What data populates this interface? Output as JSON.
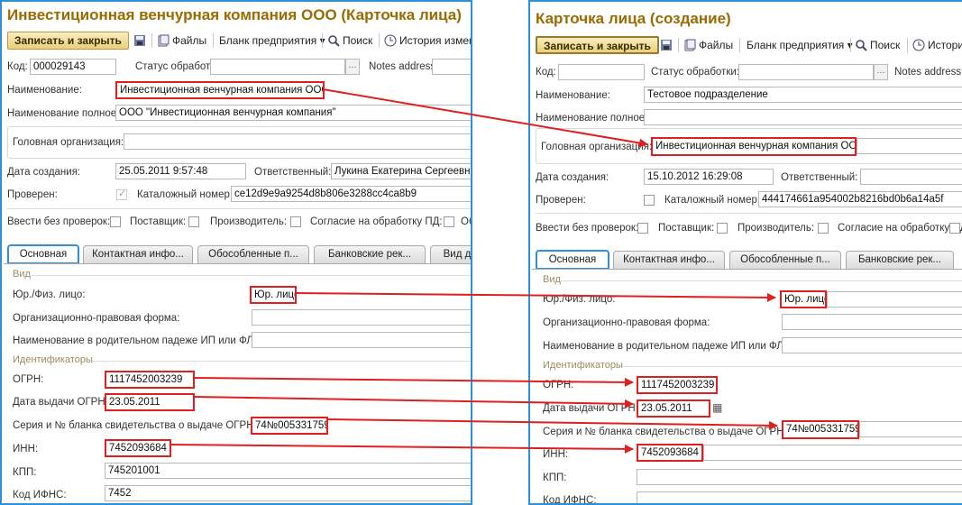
{
  "left": {
    "title": "Инвестиционная венчурная компания ООО (Карточка лица)",
    "toolbar": {
      "save_close": "Записать и закрыть",
      "files": "Файлы",
      "forms": "Бланк предприятия",
      "search": "Поиск",
      "history": "История измен"
    },
    "code_label": "Код:",
    "code_value": "000029143",
    "status_label": "Статус обработки:",
    "status_value": "",
    "notes_label": "Notes address:",
    "name_label": "Наименование:",
    "name_value": "Инвестиционная венчурная компания ООО",
    "fullname_label": "Наименование полное:",
    "fullname_value": "ООО \"Инвестиционная венчурная компания\"",
    "parent_label": "Головная организация:",
    "parent_value": "",
    "created_label": "Дата создания:",
    "created_value": "25.05.2011  9:57:48",
    "resp_label": "Ответственный:",
    "resp_value": "Лукина Екатерина Сергеевна",
    "checked_label": "Проверен:",
    "catalog_label": "Каталожный номер:",
    "catalog_value": "ce12d9e9a9254d8b806e3288cc4ca8b9",
    "noverify_label": "Ввести без проверок:",
    "supplier_label": "Поставщик:",
    "producer_label": "Производитель:",
    "consent_label": "Согласие на обработку ПД:",
    "consent_tail": "Об",
    "tabs": [
      "Основная",
      "Контактная инфо...",
      "Обособленные п...",
      "Банковские рек...",
      "Вид д"
    ],
    "group_vid": "Вид",
    "type_label": "Юр./Физ. лицо:",
    "type_value": "Юр. лицо",
    "legal_form_label": "Организационно-правовая форма:",
    "genitive_label": "Наименование в родительном падеже ИП или ФЛ:",
    "group_ids": "Идентификаторы",
    "ogrn_label": "ОГРН:",
    "ogrn_value": "1117452003239",
    "ogrn_date_label": "Дата выдачи ОГРН",
    "ogrn_date_value": "23.05.2011",
    "cert_label": "Серия и № бланка свидетельства о выдаче ОГРН :",
    "cert_value": "74№005331759",
    "inn_label": "ИНН:",
    "inn_value": "7452093684",
    "kpp_label": "КПП:",
    "kpp_value": "745201001",
    "ifns_label": "Код ИФНС:",
    "ifns_value": "7452"
  },
  "right": {
    "title": "Карточка лица (создание)",
    "toolbar": {
      "save_close": "Записать и закрыть",
      "files": "Файлы",
      "forms": "Бланк предприятия",
      "search": "Поиск",
      "history": "Истори"
    },
    "code_label": "Код:",
    "code_value": "",
    "status_label": "Статус обработки:",
    "notes_label": "Notes address:",
    "name_label": "Наименование:",
    "name_value": "Тестовое подразделение",
    "fullname_label": "Наименование полное:",
    "parent_label": "Головная организация:",
    "parent_value": "Инвестиционная венчурная компания ООО",
    "created_label": "Дата создания:",
    "created_value": "15.10.2012 16:29:08",
    "resp_label": "Ответственный:",
    "checked_label": "Проверен:",
    "catalog_label": "Каталожный номер:",
    "catalog_value": "444174661a954002b8216bd0b6a14a5f",
    "noverify_label": "Ввести без проверок:",
    "supplier_label": "Поставщик:",
    "producer_label": "Производитель:",
    "consent_label": "Согласие на обработку ПД",
    "tabs": [
      "Основная",
      "Контактная инфо...",
      "Обособленные п...",
      "Банковские рек..."
    ],
    "group_vid": "Вид",
    "type_label": "Юр./Физ. лицо:",
    "type_value": "Юр. лицо",
    "legal_form_label": "Организационно-правовая форма:",
    "genitive_label": "Наименование в родительном падеже ИП или ФЛ:",
    "group_ids": "Идентификаторы",
    "ogrn_label": "ОГРН:",
    "ogrn_value": "1117452003239",
    "ogrn_date_label": "Дата выдачи ОГРН",
    "ogrn_date_value": "23.05.2011",
    "cert_label": "Серия и № бланка свидетельства о выдаче ОГРН:",
    "cert_value": "74№005331759",
    "inn_label": "ИНН:",
    "inn_value": "7452093684",
    "kpp_label": "КПП:",
    "ifns_label": "Код ИФНС:"
  },
  "colors": {
    "accent": "#2f8fd8",
    "highlight": "#e02020",
    "title": "#9b6a00"
  }
}
